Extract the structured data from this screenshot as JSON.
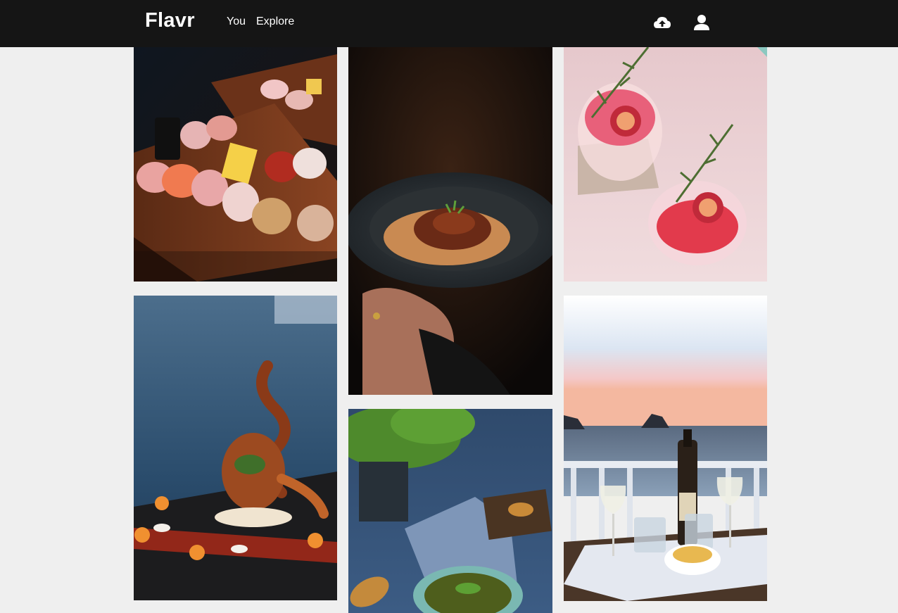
{
  "app": {
    "name": "Flavr"
  },
  "nav": {
    "links": [
      {
        "label": "You"
      },
      {
        "label": "Explore"
      }
    ],
    "icons": {
      "upload": "cloud-upload-icon",
      "profile": "user-icon"
    }
  },
  "theme": {
    "navbar_bg": "#151515",
    "page_bg": "#efefef",
    "text": "#ffffff"
  },
  "gallery": {
    "photos": [
      {
        "subject": "sushi-platter"
      },
      {
        "subject": "spaghetti-bolognese-bowl"
      },
      {
        "subject": "fig-cocktails"
      },
      {
        "subject": "grilled-octopus-dish"
      },
      {
        "subject": "green-soup-with-bread"
      },
      {
        "subject": "wine-by-the-sea"
      }
    ]
  }
}
